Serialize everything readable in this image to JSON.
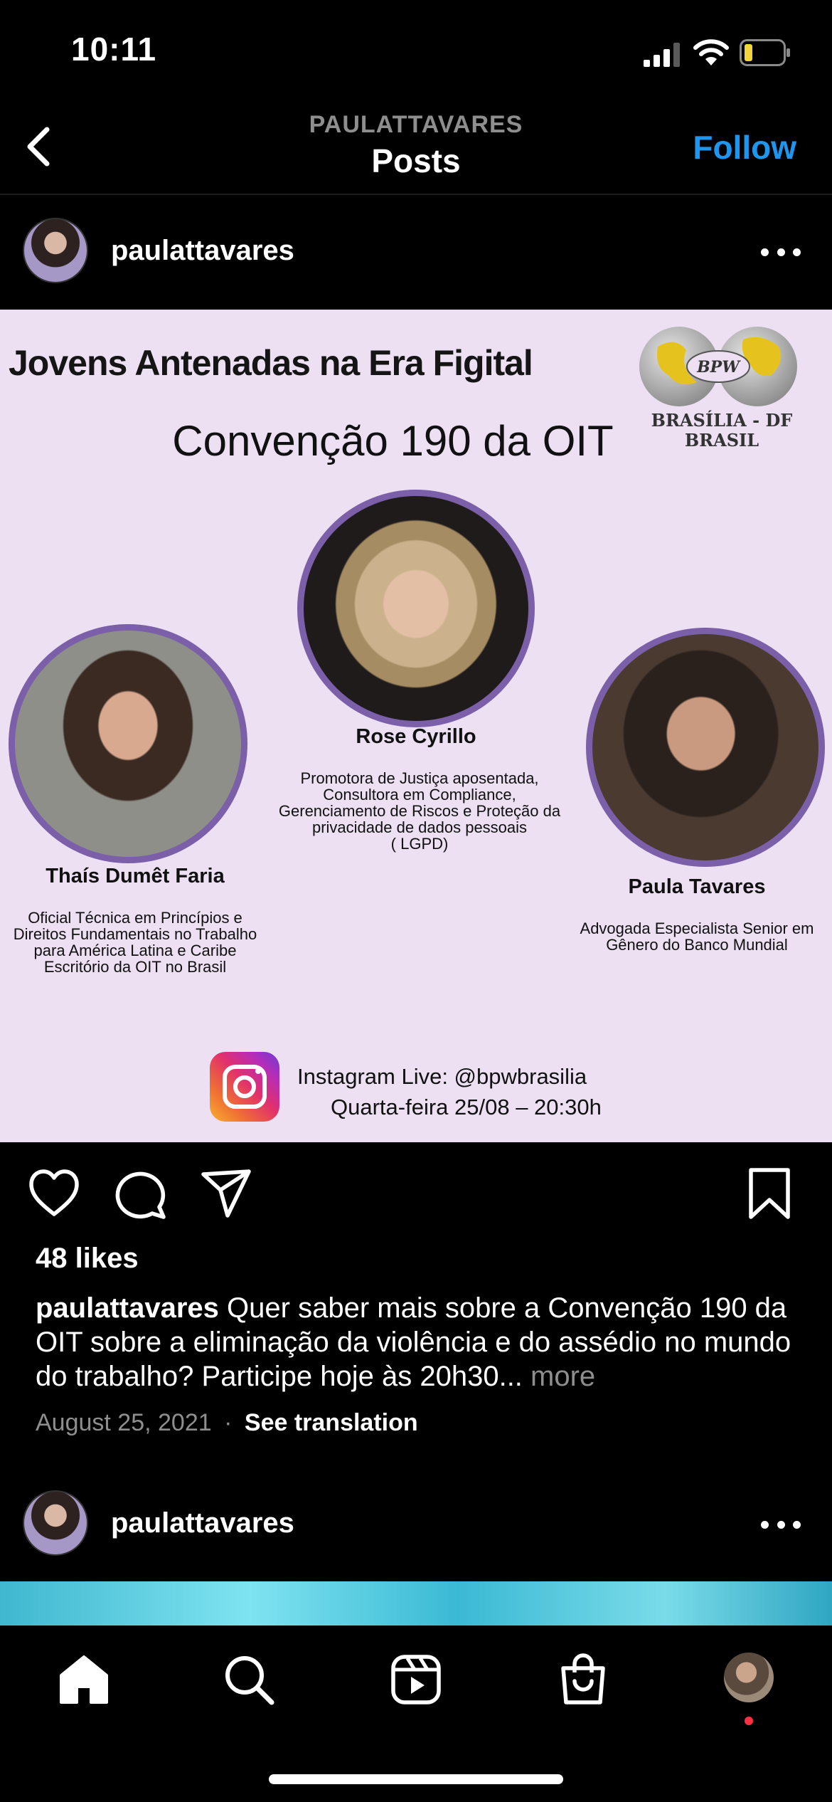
{
  "status_bar": {
    "time": "10:11"
  },
  "nav": {
    "username": "PAULATTAVARES",
    "title": "Posts",
    "follow_label": "Follow"
  },
  "post": {
    "username": "paulattavares",
    "poster": {
      "headline": "Jovens Antenadas na Era Figital",
      "logo": {
        "mark": "BPW",
        "line1": "BRASÍLIA - DF",
        "line2": "BRASIL"
      },
      "subtitle": "Convenção 190 da OIT",
      "speakers": [
        {
          "name": "Rose Cyrillo",
          "role": [
            "Promotora de Justiça aposentada,",
            "Consultora em Compliance,",
            "Gerenciamento de Riscos e Proteção da",
            "privacidade de dados pessoais",
            "( LGPD)"
          ]
        },
        {
          "name": "Thaís Dumêt Faria",
          "role": [
            "Oficial Técnica em Princípios e",
            "Direitos Fundamentais no Trabalho",
            "para América Latina e Caribe",
            "Escritório da OIT no Brasil"
          ]
        },
        {
          "name": "Paula Tavares",
          "role": [
            "Advogada Especialista Senior em",
            "Gênero do Banco Mundial"
          ]
        }
      ],
      "live_line1": "Instagram Live: @bpwbrasilia",
      "live_line2": "Quarta-feira 25/08 – 20:30h"
    },
    "likes": "48 likes",
    "caption_user": "paulattavares",
    "caption_text": "Quer saber mais sobre a Convenção 190 da OIT sobre a eliminação da violência e do assédio no mundo do trabalho? Participe hoje às 20h30...",
    "caption_more": "more",
    "date": "August 25, 2021",
    "separator": "·",
    "see_translation": "See translation"
  },
  "next_post": {
    "username": "paulattavares"
  },
  "icons": [
    "back-icon",
    "more-icon",
    "heart-icon",
    "comment-icon",
    "share-icon",
    "bookmark-icon",
    "home-icon",
    "search-icon",
    "reels-icon",
    "shop-icon"
  ],
  "colors": {
    "follow": "#1e96f0",
    "poster_bg": "#ece0f2",
    "photo_ring": "#7b5fa8",
    "notif": "#ff3040"
  }
}
